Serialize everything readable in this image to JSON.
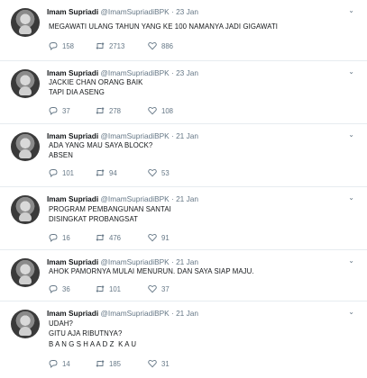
{
  "tweets": [
    {
      "name": "Imam Supriadi",
      "meta": "@ImamSupriadiBPK · 23 Jan",
      "lines": [
        "MEGAWATI ULANG TAHUN YANG KE 100 NAMANYA JADI GIGAWATI"
      ],
      "replies": "158",
      "retweets": "2713",
      "likes": "886"
    },
    {
      "name": "Imam Supriadi",
      "meta": "@ImamSupriadiBPK · 23 Jan",
      "lines": [
        "JACKIE CHAN ORANG BAIK",
        "TAPI DIA ASENG"
      ],
      "replies": "37",
      "retweets": "278",
      "likes": "108"
    },
    {
      "name": "Imam Supriadi",
      "meta": "@ImamSupriadiBPK · 21 Jan",
      "lines": [
        "ADA YANG MAU SAYA BLOCK?",
        "ABSEN"
      ],
      "replies": "101",
      "retweets": "94",
      "likes": "53"
    },
    {
      "name": "Imam Supriadi",
      "meta": "@ImamSupriadiBPK · 21 Jan",
      "lines": [
        "PROGRAM PEMBANGUNAN SANTAI",
        "DISINGKAT PROBANGSAT"
      ],
      "replies": "16",
      "retweets": "476",
      "likes": "91"
    },
    {
      "name": "Imam Supriadi",
      "meta": "@ImamSupriadiBPK · 21 Jan",
      "lines": [
        "AHOK PAMORNYA MULAI MENURUN. DAN SAYA SIAP MAJU."
      ],
      "replies": "36",
      "retweets": "101",
      "likes": "37"
    },
    {
      "name": "Imam Supriadi",
      "meta": "@ImamSupriadiBPK · 21 Jan",
      "lines": [
        "UDAH?",
        "GITU AJA RIBUTNYA?",
        "B A N G S H A A D Z  K A U"
      ],
      "replies": "14",
      "retweets": "185",
      "likes": "31"
    }
  ],
  "icons": {
    "reply": "reply-icon",
    "retweet": "retweet-icon",
    "like": "heart-icon",
    "menu": "chevron-down-icon"
  },
  "colors": {
    "text": "#14171a",
    "muted": "#657786",
    "divider": "#e6ecf0"
  }
}
